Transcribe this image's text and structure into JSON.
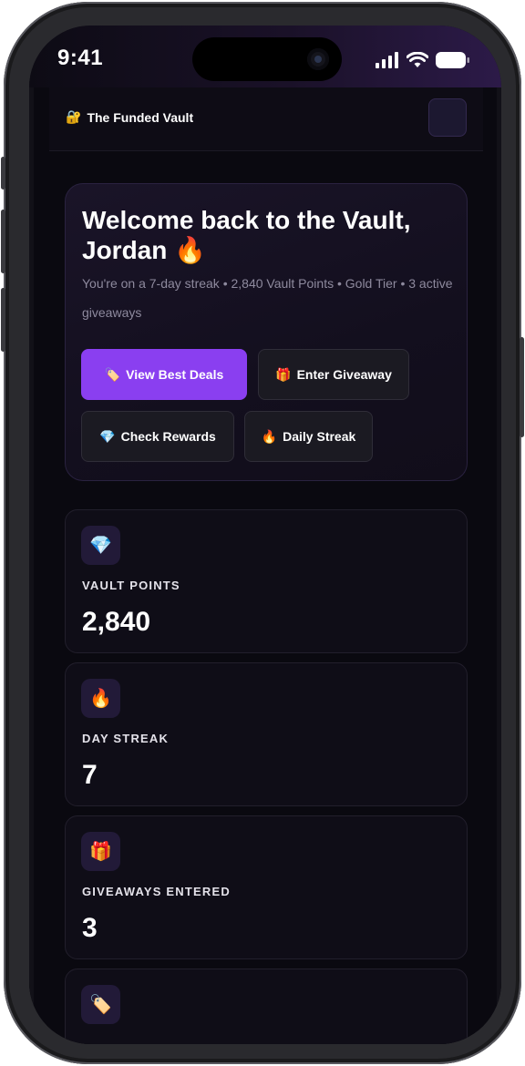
{
  "status_bar": {
    "time": "9:41"
  },
  "header": {
    "brand_name": "The Funded Vault",
    "brand_icon": "lock-with-key-icon"
  },
  "hero": {
    "title": "Welcome back to the Vault, Jordan 🔥",
    "subtitle": "You're on a 7-day streak • 2,840 Vault Points • Gold Tier • 3 active giveaways",
    "buttons": [
      {
        "icon": "🏷️",
        "label": "View Best Deals",
        "primary": true
      },
      {
        "icon": "🎁",
        "label": "Enter Giveaway"
      },
      {
        "icon": "💎",
        "label": "Check Rewards"
      },
      {
        "icon": "🔥",
        "label": "Daily Streak"
      }
    ]
  },
  "stats": [
    {
      "icon": "💎",
      "icon_name": "gem-icon",
      "label": "VAULT POINTS",
      "value": "2,840"
    },
    {
      "icon": "🔥",
      "icon_name": "fire-icon",
      "label": "DAY STREAK",
      "value": "7"
    },
    {
      "icon": "🎁",
      "icon_name": "gift-icon",
      "label": "GIVEAWAYS ENTERED",
      "value": "3"
    },
    {
      "icon": "🏷️",
      "icon_name": "tag-icon",
      "label": "",
      "value": ""
    }
  ],
  "colors": {
    "accent": "#8a3ff0",
    "background": "#0a0910",
    "card": "#0f0d17"
  }
}
